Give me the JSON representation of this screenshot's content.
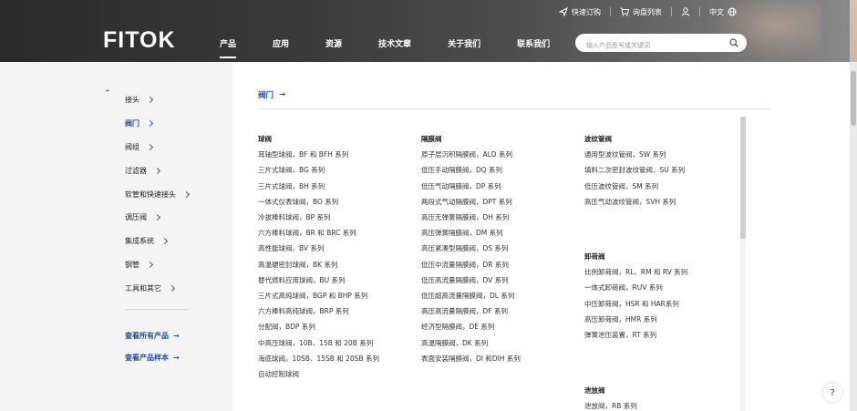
{
  "topbar": {
    "quick_order": "快速订购",
    "inquiry_list": "询盘列表",
    "language": "中文"
  },
  "logo": "FITOK",
  "nav": [
    "产品",
    "应用",
    "资源",
    "技术文章",
    "关于我们",
    "联系我们"
  ],
  "search": {
    "placeholder": "输入产品型号或关键词"
  },
  "sidebar": {
    "categories": [
      {
        "label": "接头"
      },
      {
        "label": "阀门"
      },
      {
        "label": "阀组"
      },
      {
        "label": "过滤器"
      },
      {
        "label": "软管和快速接头"
      },
      {
        "label": "调压阀"
      },
      {
        "label": "集成系统"
      },
      {
        "label": "钢管"
      },
      {
        "label": "工具和其它"
      }
    ],
    "view_all": "查看所有产品",
    "view_catalog": "查看产品样本"
  },
  "breadcrumb": "阀门",
  "columns": [
    {
      "groups": [
        {
          "title": "球阀",
          "items": [
            "耳轴型球阀，BF 和 BFH 系列",
            "三片式球阀，BG 系列",
            "三片式球阀，BH 系列",
            "一体式仪表球阀，BO 系列",
            "冷拔棒料球阀，BP 系列",
            "六方棒料球阀，BR 和 BRC 系列",
            "高性能球阀，BV 系列",
            "高温硬密封球阀，BK 系列",
            "替代燃料应用球阀，BU 系列",
            "三片式高纯球阀，BGP 和 BHP 系列",
            "六方棒料高纯球阀，BRP 系列",
            "分配阀，BDP 系列",
            "中高压球阀，10B、15B 和 20B 系列",
            "海底球阀，10SB、15SB 和 20SB 系列",
            "自动控制球阀"
          ]
        }
      ]
    },
    {
      "groups": [
        {
          "title": "隔膜阀",
          "items": [
            "原子层沉积隔膜阀，ALD 系列",
            "低压手动隔膜阀，DQ 系列",
            "低压气动隔膜阀，DP 系列",
            "两段式气动隔膜阀，DPT 系列",
            "高压无弹簧隔膜阀，DH 系列",
            "高压弹簧隔膜阀，DM 系列",
            "高压紧凑型隔膜阀，DS 系列",
            "低压中流量隔膜阀，DR 系列",
            "低压高流量隔膜阀，DV 系列",
            "低压超高流量隔膜阀，DL 系列",
            "高压高流量隔膜阀，DF 系列",
            "经济型隔膜阀，DE 系列",
            "高温隔膜阀，DK 系列",
            "表面安装隔膜阀，DI 和DIH 系列"
          ]
        }
      ]
    },
    {
      "groups": [
        {
          "title": "波纹管阀",
          "items": [
            "通用型波纹管阀，SW 系列",
            "填料二次密封波纹管阀，SU 系列",
            "低压波纹管阀，SM 系列",
            "高压气动波纹管阀，SVH 系列"
          ]
        },
        {
          "title": "卸荷阀",
          "items": [
            "比例卸荷阀，RL、RM 和 RV 系列",
            "一体式卸荷阀，RUV 系列",
            "中压卸荷阀，HSR 和 HAR系列",
            "高压卸荷阀，HMR 系列",
            "弹簧泄压装置，RT 系列"
          ]
        },
        {
          "title": "泄放阀",
          "items": [
            "泄放阀，RB 系列"
          ]
        }
      ]
    }
  ],
  "help": "?"
}
